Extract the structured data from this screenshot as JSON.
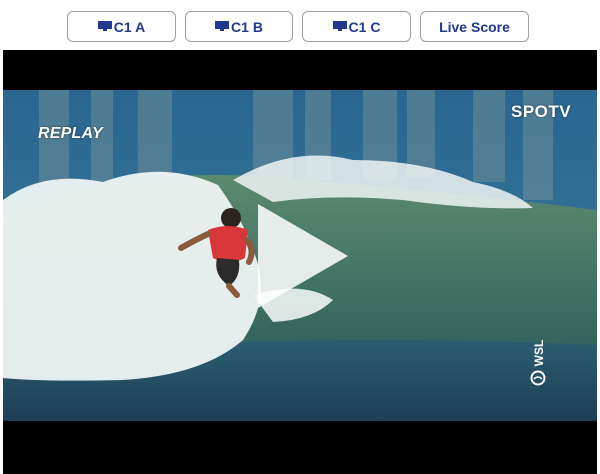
{
  "tabs": [
    {
      "label": "C1 A",
      "icon": "tv-icon"
    },
    {
      "label": "C1 B",
      "icon": "tv-icon"
    },
    {
      "label": "C1 C",
      "icon": "tv-icon"
    },
    {
      "label": "Live Score"
    }
  ],
  "video": {
    "overlay_replay": "REPLAY",
    "broadcaster_logo": "SPOTV",
    "league_logo": "WSL",
    "play_icon": "play-icon"
  },
  "colors": {
    "tab_text": "#213a8f",
    "player_bg": "#000000",
    "sky_ocean": "#2f6a8f",
    "wave": "#4f7f6a",
    "foam": "#e8f0ef",
    "wetsuit": "#d9363a"
  }
}
